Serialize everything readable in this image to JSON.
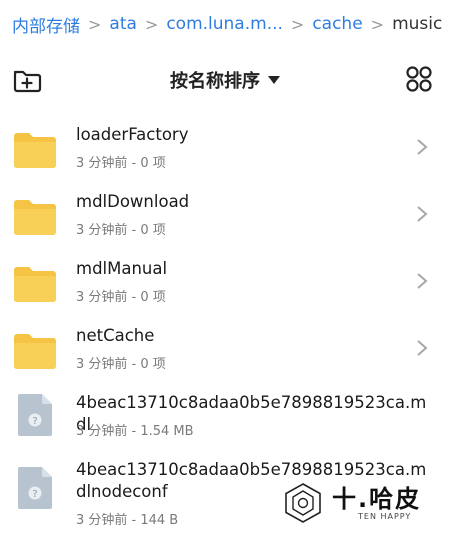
{
  "breadcrumb": {
    "items": [
      "内部存储",
      "ata",
      "com.luna.m...",
      "cache"
    ],
    "current": "music"
  },
  "toolbar": {
    "sort_label": "按名称排序",
    "icons": {
      "new_folder": "new-folder-icon",
      "grid_view": "grid-view-icon",
      "sort": "caret-down-icon"
    }
  },
  "items": [
    {
      "type": "folder",
      "name": "loaderFactory",
      "meta": "3 分钟前 - 0 项"
    },
    {
      "type": "folder",
      "name": "mdlDownload",
      "meta": "3 分钟前 - 0 项"
    },
    {
      "type": "folder",
      "name": "mdlManual",
      "meta": "3 分钟前 - 0 项"
    },
    {
      "type": "folder",
      "name": "netCache",
      "meta": "3 分钟前 - 0 项"
    },
    {
      "type": "file",
      "name": "4beac13710c8adaa0b5e7898819523ca.mdl",
      "meta": "3 分钟前 - 1.54 MB"
    },
    {
      "type": "file",
      "name": "4beac13710c8adaa0b5e7898819523ca.mdlnodeconf",
      "meta": "3 分钟前 - 144 B"
    }
  ],
  "watermark": {
    "title": "十.哈皮",
    "subtitle": "TEN HAPPY"
  },
  "colors": {
    "accent": "#2f7de1",
    "folder": "#f5c445",
    "file": "#b7c3cf"
  }
}
